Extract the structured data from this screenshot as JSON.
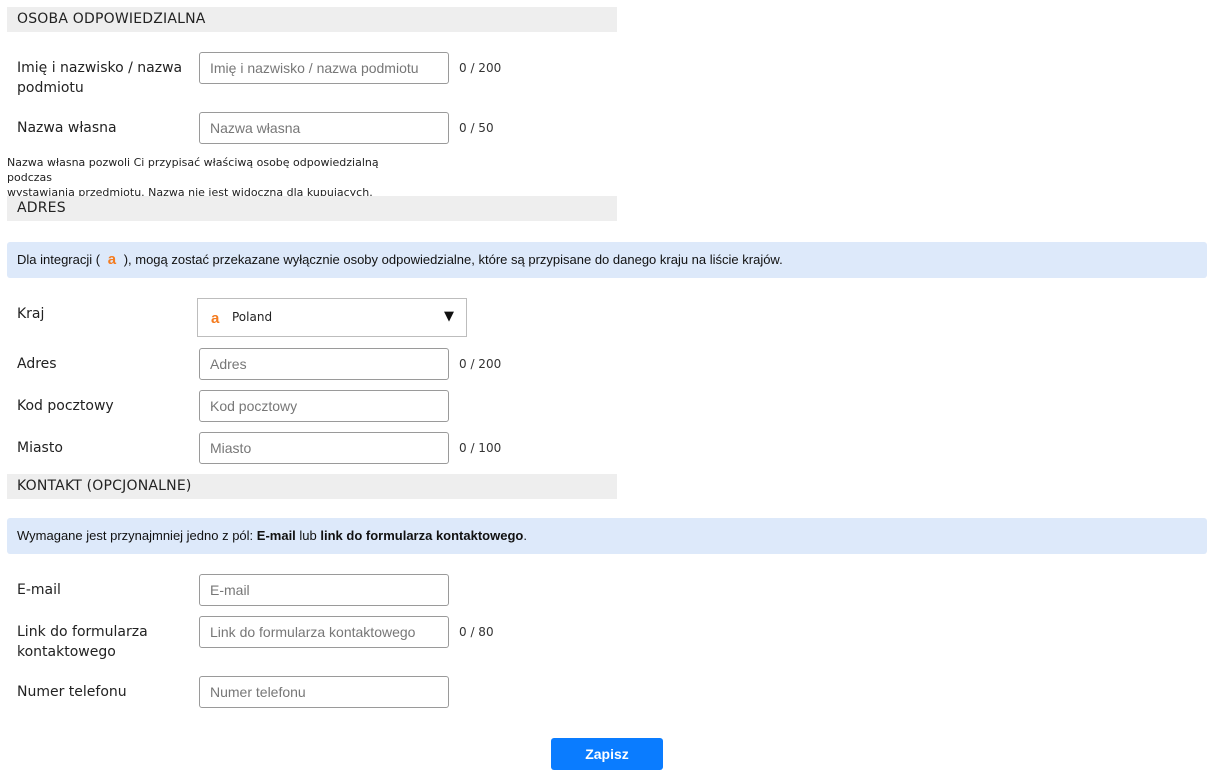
{
  "sections": {
    "person_title": "OSOBA ODPOWIEDZIALNA",
    "address_title": "ADRES",
    "contact_title": "KONTAKT (OPCJONALNE)"
  },
  "person": {
    "name_label_line1": "Imię i nazwisko / nazwa",
    "name_label_line2": "podmiotu",
    "name_placeholder": "Imię i nazwisko / nazwa podmiotu",
    "name_value": "",
    "name_counter": "0 / 200",
    "own_name_label": "Nazwa własna",
    "own_name_placeholder": "Nazwa własna",
    "own_name_value": "",
    "own_name_counter": "0 / 50",
    "hint_line1": "Nazwa własna pozwoli Ci przypisać właściwą osobę odpowiedzialną podczas",
    "hint_line2": "wystawiania przedmiotu. Nazwa nie jest widoczna dla kupujących."
  },
  "address": {
    "info_prefix": "Dla integracji (",
    "info_logo": "a",
    "info_suffix": "), mogą zostać przekazane wyłącznie osoby odpowiedzialne, które są przypisane do danego kraju na liście krajów.",
    "country_label": "Kraj",
    "country_logo": "a",
    "country_value": "Poland",
    "country_caret": "▼",
    "address_label": "Adres",
    "address_placeholder": "Adres",
    "address_value": "",
    "address_counter": "0 / 200",
    "zip_label": "Kod pocztowy",
    "zip_placeholder": "Kod pocztowy",
    "zip_value": "",
    "city_label": "Miasto",
    "city_placeholder": "Miasto",
    "city_value": "",
    "city_counter": "0 / 100"
  },
  "contact": {
    "info_prefix": "Wymagane jest przynajmniej jedno z pól: ",
    "info_bold1": "E-mail",
    "info_mid": " lub ",
    "info_bold2": "link do formularza kontaktowego",
    "info_end": ".",
    "email_label": "E-mail",
    "email_placeholder": "E-mail",
    "email_value": "",
    "link_label_line1": "Link do formularza",
    "link_label_line2": "kontaktowego",
    "link_placeholder": "Link do formularza kontaktowego",
    "link_value": "",
    "link_counter": "0 / 80",
    "phone_label": "Numer telefonu",
    "phone_placeholder": "Numer telefonu",
    "phone_value": ""
  },
  "actions": {
    "save_label": "Zapisz"
  },
  "colors": {
    "accent": "#0a7cff",
    "info_bg": "#dde9fa",
    "section_bg": "#eeeeee",
    "brand_logo": "#f47c20"
  }
}
